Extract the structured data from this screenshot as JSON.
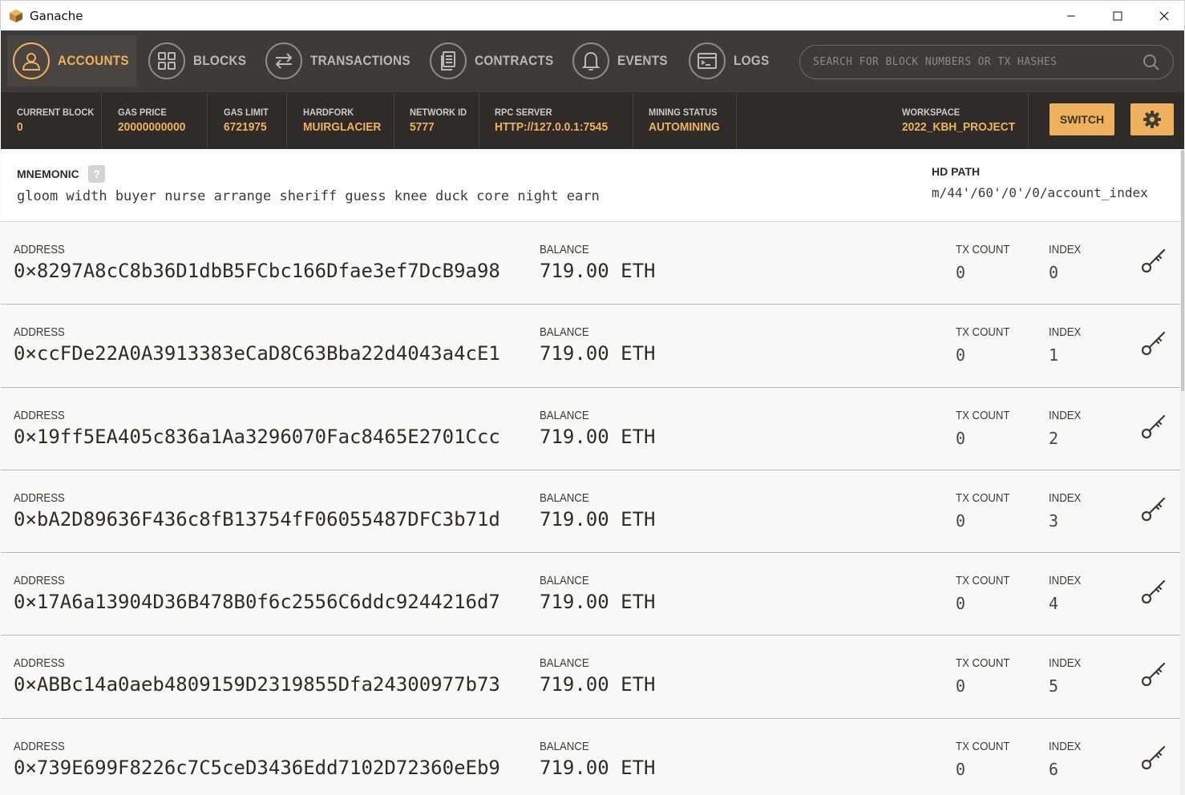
{
  "window": {
    "title": "Ganache"
  },
  "nav": {
    "items": [
      {
        "label": "ACCOUNTS",
        "icon": "user-icon",
        "active": true
      },
      {
        "label": "BLOCKS",
        "icon": "blocks-icon",
        "active": false
      },
      {
        "label": "TRANSACTIONS",
        "icon": "transactions-icon",
        "active": false
      },
      {
        "label": "CONTRACTS",
        "icon": "contracts-icon",
        "active": false
      },
      {
        "label": "EVENTS",
        "icon": "bell-icon",
        "active": false
      },
      {
        "label": "LOGS",
        "icon": "logs-icon",
        "active": false
      }
    ],
    "search_placeholder": "SEARCH FOR BLOCK NUMBERS OR TX HASHES"
  },
  "status": {
    "current_block": {
      "label": "CURRENT BLOCK",
      "value": "0"
    },
    "gas_price": {
      "label": "GAS PRICE",
      "value": "20000000000"
    },
    "gas_limit": {
      "label": "GAS LIMIT",
      "value": "6721975"
    },
    "hardfork": {
      "label": "HARDFORK",
      "value": "MUIRGLACIER"
    },
    "network_id": {
      "label": "NETWORK ID",
      "value": "5777"
    },
    "rpc_server": {
      "label": "RPC SERVER",
      "value": "HTTP://127.0.0.1:7545"
    },
    "mining_status": {
      "label": "MINING STATUS",
      "value": "AUTOMINING"
    },
    "workspace": {
      "label": "WORKSPACE",
      "value": "2022_KBH_PROJECT"
    },
    "switch_label": "SWITCH"
  },
  "mnemonic": {
    "label": "MNEMONIC",
    "help": "?",
    "words": "gloom width buyer nurse arrange sheriff guess knee duck core night earn",
    "hd_path_label": "HD PATH",
    "hd_path": "m/44'/60'/0'/0/account_index"
  },
  "account_labels": {
    "address": "ADDRESS",
    "balance": "BALANCE",
    "tx_count": "TX COUNT",
    "index": "INDEX"
  },
  "accounts": [
    {
      "address": "0×8297A8cC8b36D1dbB5FCbc166Dfae3ef7DcB9a98",
      "balance": "719.00 ETH",
      "tx_count": "0",
      "index": "0"
    },
    {
      "address": "0×ccFDe22A0A3913383eCaD8C63Bba22d4043a4cE1",
      "balance": "719.00 ETH",
      "tx_count": "0",
      "index": "1"
    },
    {
      "address": "0×19ff5EA405c836a1Aa3296070Fac8465E2701Ccc",
      "balance": "719.00 ETH",
      "tx_count": "0",
      "index": "2"
    },
    {
      "address": "0×bA2D89636F436c8fB13754fF06055487DFC3b71d",
      "balance": "719.00 ETH",
      "tx_count": "0",
      "index": "3"
    },
    {
      "address": "0×17A6a13904D36B478B0f6c2556C6ddc9244216d7",
      "balance": "719.00 ETH",
      "tx_count": "0",
      "index": "4"
    },
    {
      "address": "0×ABBc14a0aeb4809159D2319855Dfa24300977b73",
      "balance": "719.00 ETH",
      "tx_count": "0",
      "index": "5"
    },
    {
      "address": "0×739E699F8226c7C5ceD3436Edd7102D72360eEb9",
      "balance": "719.00 ETH",
      "tx_count": "0",
      "index": "6"
    }
  ],
  "colors": {
    "accent": "#f0b15d",
    "nav_bg": "#3e3a36",
    "status_bg": "#2f2b28"
  }
}
